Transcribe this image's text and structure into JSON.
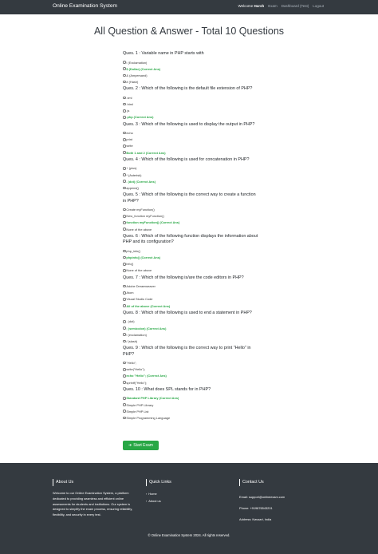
{
  "navbar": {
    "brand": "Online Examination System",
    "welcome_prefix": "Welcome ",
    "username": "Harsh",
    "links": [
      "Exam",
      "Dashboard (Test)",
      "Logout"
    ]
  },
  "page_title": "All Question & Answer - Total 10 Questions",
  "questions": [
    {
      "text": "Ques. 1 : Variable name in PHP starts with",
      "options": [
        "! (Exclamation)",
        "$ (Dollar) (Correct Ans)",
        "& (Ampersand)",
        "# (Hash)"
      ],
      "correct": 1
    },
    {
      "text": "Ques. 2 : Which of the following is the default file extension of PHP?",
      "options": [
        ".xml",
        ".html",
        ".js",
        ".php (Correct Ans)"
      ],
      "correct": 3
    },
    {
      "text": "Ques. 3 : Which of the following is used to display the output in PHP?",
      "options": [
        "echo",
        "print",
        "write",
        "Both 1 and 2 (Correct Ans)"
      ],
      "correct": 3
    },
    {
      "text": "Ques. 4 : Which of the following is used for concatenation in PHP?",
      "options": [
        "+ (plus)",
        "* (Asterisk)",
        ". (dot) (Correct Ans)",
        "append()"
      ],
      "correct": 2
    },
    {
      "text": "Ques. 5 : Which of the following is the correct way to create a function in PHP?",
      "options": [
        "Create myFunction()",
        "New_function myFunction()",
        "function myFunction() (Correct Ans)",
        "None of the above"
      ],
      "correct": 2
    },
    {
      "text": "Ques. 6 : Which of the following function displays the information about PHP and its configuration?",
      "options": [
        "php_info()",
        "phpinfo() (Correct Ans)",
        "info()",
        "None of the above"
      ],
      "correct": 1
    },
    {
      "text": "Ques. 7 : Which of the following is/are the code editors in PHP?",
      "options": [
        "Adobe Dreamweaver",
        "Atom",
        "Visual Studio Code",
        "All of the above (Correct Ans)"
      ],
      "correct": 3
    },
    {
      "text": "Ques. 8 : Which of the following is used to end a statement in PHP?",
      "options": [
        ". (dot)",
        "; (semicolon) (Correct Ans)",
        "! (exclamation)",
        "/ (slash)"
      ],
      "correct": 1
    },
    {
      "text": "Ques. 9 : Which of the following is the correct way to print \"Hello\" in PHP?",
      "options": [
        "\"Hello\";",
        "write(\"Hello\");",
        "echo \"Hello\"; (Correct Ans)",
        "sprintf(\"Hello\");"
      ],
      "correct": 2
    },
    {
      "text": "Ques. 10 : What does SPL stands for in PHP?",
      "options": [
        "Standard PHP Library (Correct Ans)",
        "Simple PHP Library",
        "Simple PHP List",
        "Simple Programming Language"
      ],
      "correct": 0
    }
  ],
  "start_button": "Start Exam",
  "footer": {
    "about_title": "About Us",
    "about_text": "Welcome to our Online Examination System, a platform dedicated to providing seamless and efficient online assessments for students and institutions. Our system is designed to simplify the exam process, ensuring reliability, flexibility, and security in every test.",
    "quick_links_title": "Quick Links",
    "quick_links": [
      "Home",
      "About us"
    ],
    "contact_title": "Contact Us",
    "email": "Email: support@onlineexam.com",
    "phone": "Phone: +919876543201",
    "address": "Address: Navsari, India",
    "copyright": "© Online Examination System 2024. All rights reserved."
  }
}
